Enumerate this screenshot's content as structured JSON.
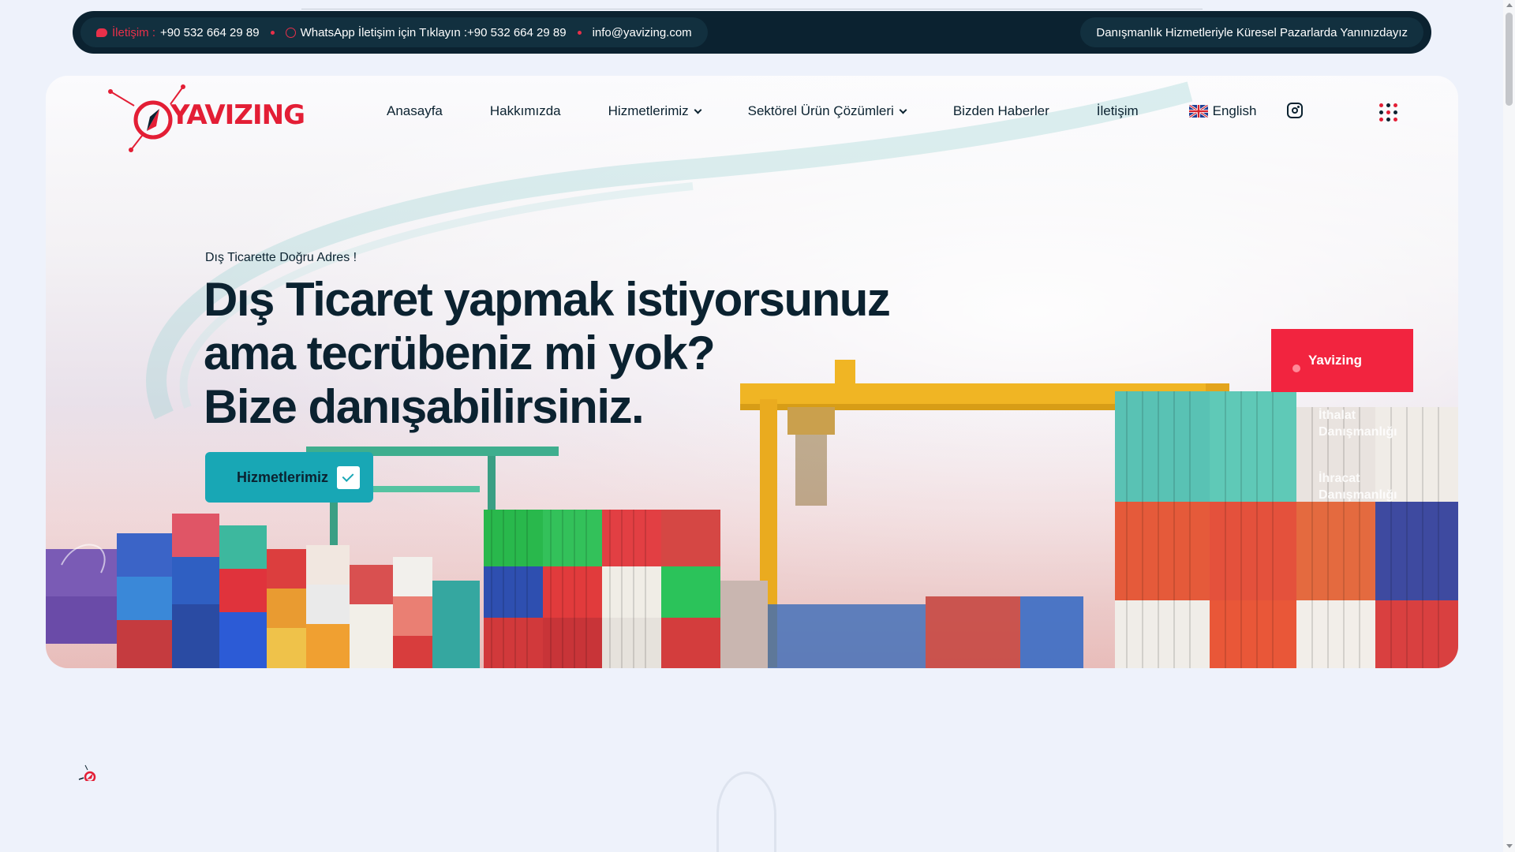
{
  "topbar": {
    "contact_label": "İletişim :",
    "contact_phone": "+90 532 664 29 89",
    "whatsapp_text": "WhatsApp İletişim için Tıklayın :+90 532 664 29 89",
    "email": "info@yavizing.com",
    "tagline": "Danışmanlık Hizmetleriyle Küresel Pazarlarda Yanınızdayız"
  },
  "brand": {
    "logo_text": "YAVIZING",
    "primary_color": "#e31e35",
    "dark_color": "#0b2230",
    "accent_color": "#18a7b5"
  },
  "nav": {
    "items": [
      {
        "label": "Anasayfa"
      },
      {
        "label": "Hakkımızda"
      },
      {
        "label": "Hizmetlerimiz",
        "dropdown": true
      },
      {
        "label": "Sektörel Ürün Çözümleri",
        "dropdown": true
      },
      {
        "label": "Bizden Haberler"
      },
      {
        "label": "İletişim"
      }
    ],
    "language": "English",
    "icons": [
      "flag-uk-icon",
      "instagram-icon",
      "grid-menu-icon"
    ]
  },
  "hero": {
    "eyebrow": "Dış Ticarette Doğru Adres !",
    "headline_lines": [
      "Dış Ticaret yapmak istiyorsunuz",
      "ama tecrübeniz mi yok?",
      "Bize danışabilirsiniz."
    ],
    "cta_label": "Hizmetlerimiz"
  },
  "slides": {
    "active": "Yavizing",
    "items": [
      {
        "line1": "İthalat",
        "line2": "Danışmanlığı"
      },
      {
        "line1": "İhracat",
        "line2": "Danışmanlığı"
      }
    ]
  }
}
